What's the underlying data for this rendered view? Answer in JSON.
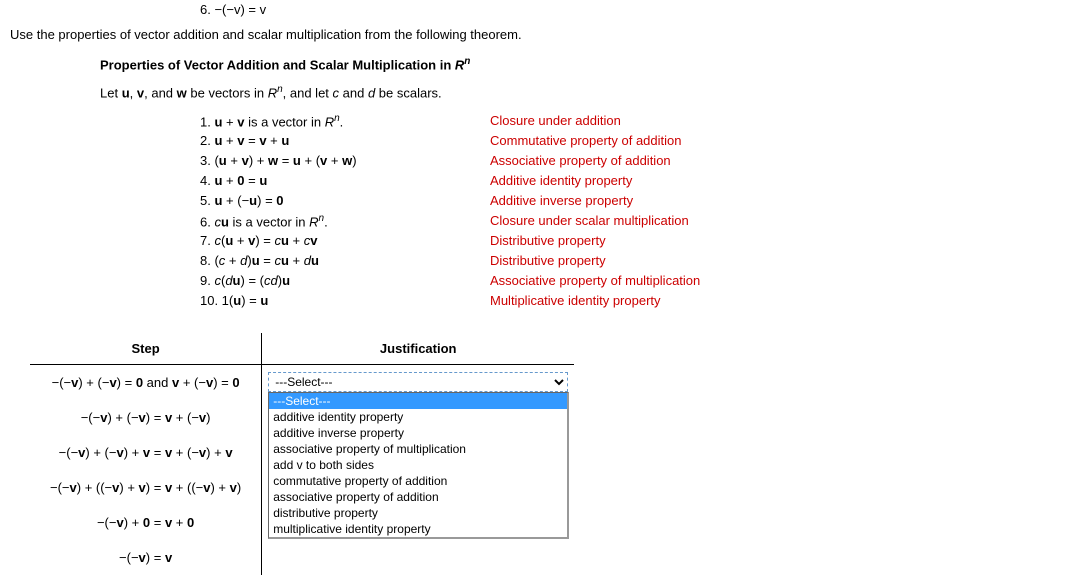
{
  "header": {
    "item6": "6. −(−v) = v",
    "instruction": "Use the properties of vector addition and scalar multiplication from the following theorem.",
    "theorem_title_prefix": "Properties of Vector Addition and Scalar Multiplication in ",
    "theorem_title_suffix": "R",
    "theorem_title_sup": "n",
    "let_prefix": "Let ",
    "let_u": "u",
    "let_sep1": ", ",
    "let_v": "v",
    "let_sep2": ", and ",
    "let_w": "w",
    "let_mid": " be vectors in ",
    "let_R": "R",
    "let_sup": "n",
    "let_sep3": ", and let ",
    "let_c": "c",
    "let_and": " and ",
    "let_d": "d",
    "let_end": " be scalars."
  },
  "properties": [
    {
      "eq_pre": "1. ",
      "eq_bold": "u",
      "eq_mid": " + ",
      "eq_bold2": "v",
      "eq_post": " is a vector in ",
      "eq_Rn": true,
      "eq_end": ".",
      "name": "Closure under addition"
    },
    {
      "eq_full": "2. u + v = v + u",
      "name": "Commutative property of addition"
    },
    {
      "eq_full": "3. (u + v) + w = u + (v + w)",
      "name": "Associative property of addition"
    },
    {
      "eq_full": "4. u + 0 = u",
      "name": "Additive identity property"
    },
    {
      "eq_full": "5. u + (−u) = 0",
      "name": "Additive inverse property"
    },
    {
      "eq_pre": "6. ",
      "eq_post2": "cu is a vector in ",
      "eq_Rn": true,
      "eq_end": ".",
      "name": "Closure under scalar multiplication"
    },
    {
      "eq_full": "7. c(u + v) = cu + cv",
      "name": "Distributive property"
    },
    {
      "eq_full": "8. (c + d)u = cu + du",
      "name": "Distributive property"
    },
    {
      "eq_full": "9. c(du) = (cd)u",
      "name": "Associative property of multiplication"
    },
    {
      "eq_full": "10. 1(u) = u",
      "name": "Multiplicative identity property"
    }
  ],
  "prop_lines": {
    "l1": "1. u + v is a vector in Rⁿ.",
    "l2": "2. u + v = v + u",
    "l3": "3. (u + v) + w = u + (v + w)",
    "l4": "4. u + 0 = u",
    "l5": "5. u + (−u) = 0",
    "l6": "6. cu is a vector in Rⁿ.",
    "l7": "7. c(u + v) = cu + cv",
    "l8": "8. (c + d)u = cu + du",
    "l9": "9. c(du) = (cd)u",
    "l10": "10. 1(u) = u"
  },
  "prop_names": {
    "n1": "Closure under addition",
    "n2": "Commutative property of addition",
    "n3": "Associative property of addition",
    "n4": "Additive identity property",
    "n5": "Additive inverse property",
    "n6": "Closure under scalar multiplication",
    "n7": "Distributive property",
    "n8": "Distributive property",
    "n9": "Associative property of multiplication",
    "n10": "Multiplicative identity property"
  },
  "table": {
    "col_step": "Step",
    "col_just": "Justification",
    "steps": {
      "s1": "−(−v) + (−v) = 0 and v + (−v) = 0",
      "s2": "−(−v) + (−v) = v + (−v)",
      "s3": "−(−v) + (−v) + v = v + (−v) + v",
      "s4": "−(−v) + ((−v) + v) = v + ((−v) + v)",
      "s5": "−(−v) + 0 = v + 0",
      "s6": "−(−v) = v"
    },
    "select_placeholder": "---Select---"
  },
  "options": {
    "o0": "---Select---",
    "o1": "additive identity property",
    "o2": "additive inverse property",
    "o3": "associative property of multiplication",
    "o4": "add v to both sides",
    "o5": "commutative property of addition",
    "o6": "associative property of addition",
    "o7": "distributive property",
    "o8": "multiplicative identity property"
  }
}
